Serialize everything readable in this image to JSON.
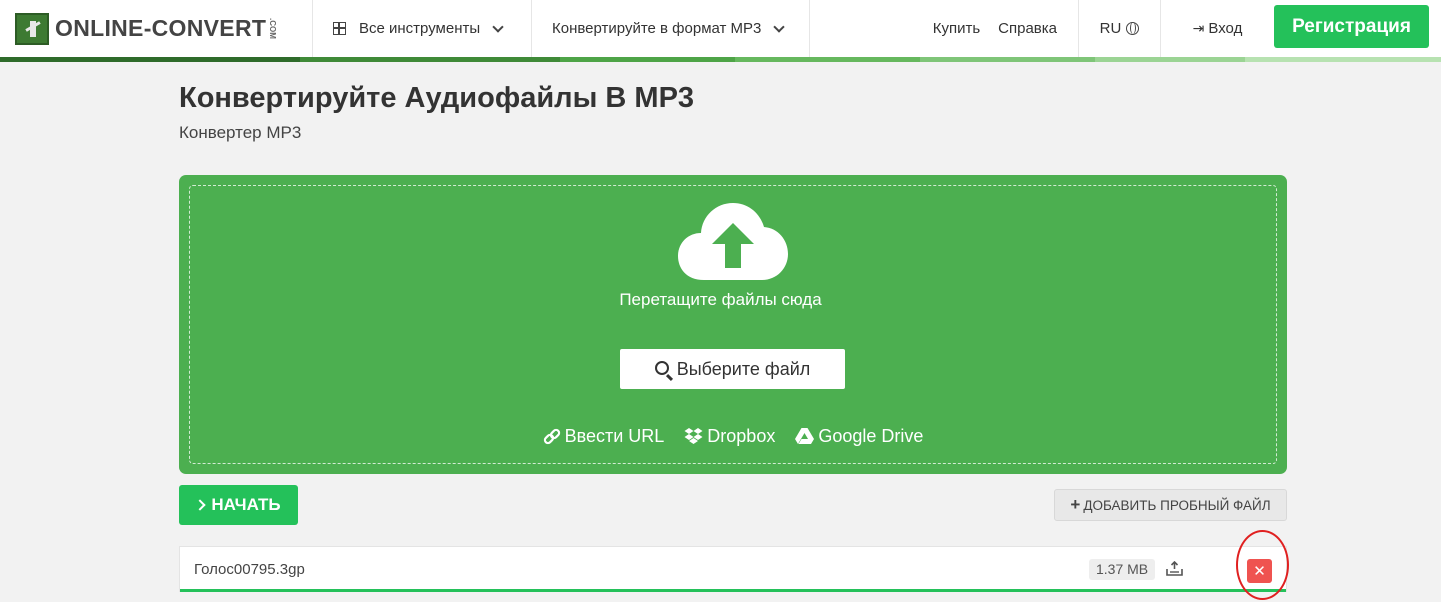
{
  "header": {
    "logo_text": "ONLINE-CONVERT",
    "logo_com": ".COM",
    "nav_tools": "Все инструменты",
    "nav_format": "Конвертируйте в формат MP3",
    "buy": "Купить",
    "help": "Справка",
    "lang": "RU",
    "login": "Вход",
    "register": "Регистрация"
  },
  "page": {
    "title": "Конвертируйте Аудиофайлы В MP3",
    "subtitle": "Конвертер MP3"
  },
  "dropzone": {
    "drop_text": "Перетащите файлы сюда",
    "choose_file": "Выберите файл",
    "enter_url": "Ввести URL",
    "dropbox": "Dropbox",
    "google_drive": "Google Drive"
  },
  "actions": {
    "start": "НАЧАТЬ",
    "add_sample": "ДОБАВИТЬ ПРОБНЫЙ ФАЙЛ"
  },
  "file": {
    "name": "Голос00795.3gp",
    "size": "1.37 MB",
    "upload_progress": 1.0
  },
  "colors": {
    "primary_green": "#24c15a",
    "dropzone_green": "#4caf50",
    "delete_red": "#ef5350",
    "annotation_red": "#e02020"
  },
  "icons": [
    "grid-icon",
    "chevron-down-icon",
    "globe-icon",
    "login-icon",
    "cloud-upload-icon",
    "search-icon",
    "link-icon",
    "dropbox-icon",
    "google-drive-icon",
    "chevron-right-icon",
    "plus-icon",
    "upload-tray-icon",
    "close-icon"
  ]
}
